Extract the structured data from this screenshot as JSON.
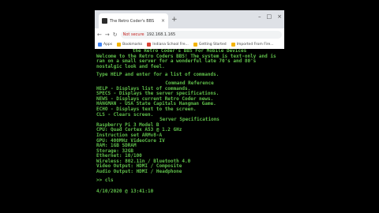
{
  "browser": {
    "tab_title": "The Retro Coder's BBS",
    "tab_close": "×",
    "new_tab": "+",
    "window_controls": [
      "–",
      "□",
      "×"
    ],
    "nav": {
      "back": "←",
      "forward": "→",
      "reload": "↻"
    },
    "address": {
      "security": "Not secure",
      "url": "192.168.1.165"
    },
    "bookmarks": [
      {
        "label": "Apps"
      },
      {
        "label": "Bookmarks"
      },
      {
        "label": "Indiana School Fre..."
      },
      {
        "label": "Getting Started"
      },
      {
        "label": "Imported From Fire..."
      }
    ]
  },
  "terminal": {
    "title": "the Retro Coder's BBS For Mobile Devices",
    "welcome": "Welcome to the Retro Coders BBS! The system is text-only and is ran on a small server for a wonderful late 70's and 80's nostalgic look and feel.",
    "help_hint": "Type HELP and enter for a list of commands.",
    "cmd_ref_title": "Command Reference",
    "commands": [
      "HELP - Displays list of commands.",
      "SPECS - Displays the server specifications.",
      "NEWS - Displays current Retro Coder news.",
      "HANGMAN - USA State Capitals Hangman Game.",
      "ECHO - Displays text to the screen.",
      "CLS - Clears screen."
    ],
    "specs_title": "Server Specifications",
    "specs": [
      "Raspberry Pi 3 Model B",
      "CPU: Quad Cortex A53 @ 1.2 GHz",
      "Instruction set ARMv8-A",
      "GPU: 400MHz VideoCore IV",
      "RAM: 1GB SDRAM",
      "Storage: 32GB",
      "Ethernet: 10/100",
      "Wireless: 802.11n / Bluetooth 4.0",
      "Video Output: HDMI / Composite",
      "Audio Output: HDMI / Headphone"
    ],
    "prompt": ">> cls",
    "timestamp": "4/10/2020 @ 13:41:10"
  }
}
